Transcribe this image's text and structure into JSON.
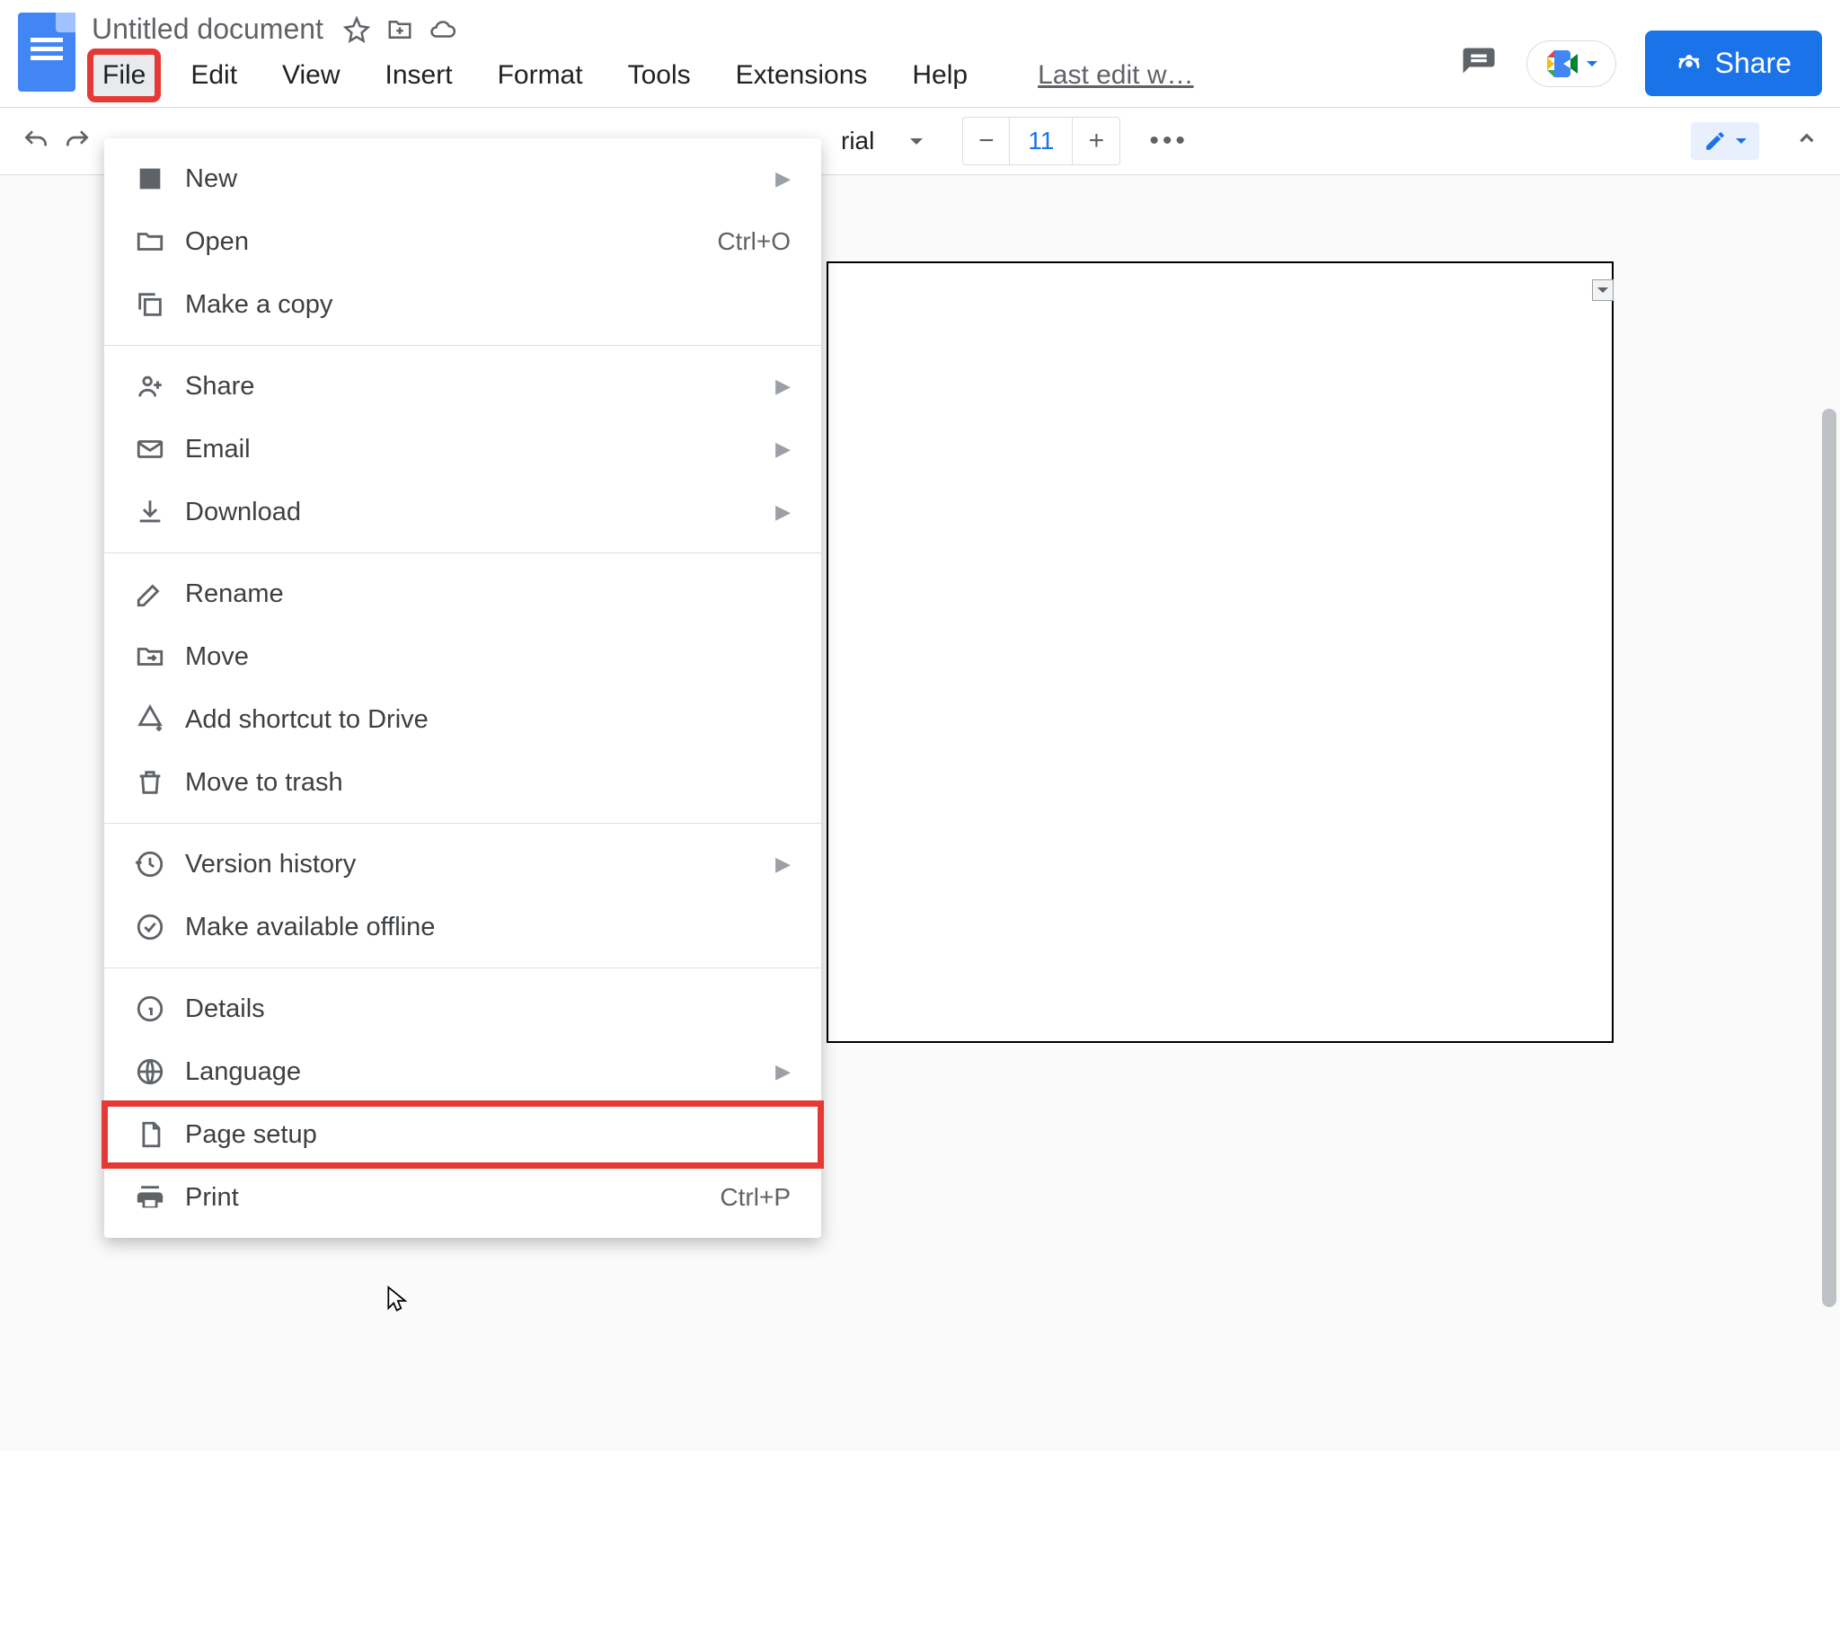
{
  "header": {
    "title": "Untitled document",
    "last_edit": "Last edit w…",
    "share_label": "Share"
  },
  "menubar": {
    "items": [
      "File",
      "Edit",
      "View",
      "Insert",
      "Format",
      "Tools",
      "Extensions",
      "Help"
    ]
  },
  "toolbar": {
    "font_visible": "rial",
    "font_size": "11"
  },
  "file_menu": {
    "items": [
      {
        "label": "New",
        "icon": "doc-icon",
        "submenu": true
      },
      {
        "label": "Open",
        "icon": "folder-icon",
        "shortcut": "Ctrl+O"
      },
      {
        "label": "Make a copy",
        "icon": "copy-icon"
      },
      {
        "type": "sep"
      },
      {
        "label": "Share",
        "icon": "person-add-icon",
        "submenu": true
      },
      {
        "label": "Email",
        "icon": "email-icon",
        "submenu": true
      },
      {
        "label": "Download",
        "icon": "download-icon",
        "submenu": true
      },
      {
        "type": "sep"
      },
      {
        "label": "Rename",
        "icon": "rename-icon"
      },
      {
        "label": "Move",
        "icon": "move-icon"
      },
      {
        "label": "Add shortcut to Drive",
        "icon": "shortcut-drive-icon"
      },
      {
        "label": "Move to trash",
        "icon": "trash-icon"
      },
      {
        "type": "sep"
      },
      {
        "label": "Version history",
        "icon": "history-icon",
        "submenu": true
      },
      {
        "label": "Make available offline",
        "icon": "offline-icon"
      },
      {
        "type": "sep"
      },
      {
        "label": "Details",
        "icon": "info-icon"
      },
      {
        "label": "Language",
        "icon": "globe-icon",
        "submenu": true
      },
      {
        "label": "Page setup",
        "icon": "page-icon",
        "highlight": "red"
      },
      {
        "label": "Print",
        "icon": "print-icon",
        "shortcut": "Ctrl+P"
      }
    ]
  }
}
